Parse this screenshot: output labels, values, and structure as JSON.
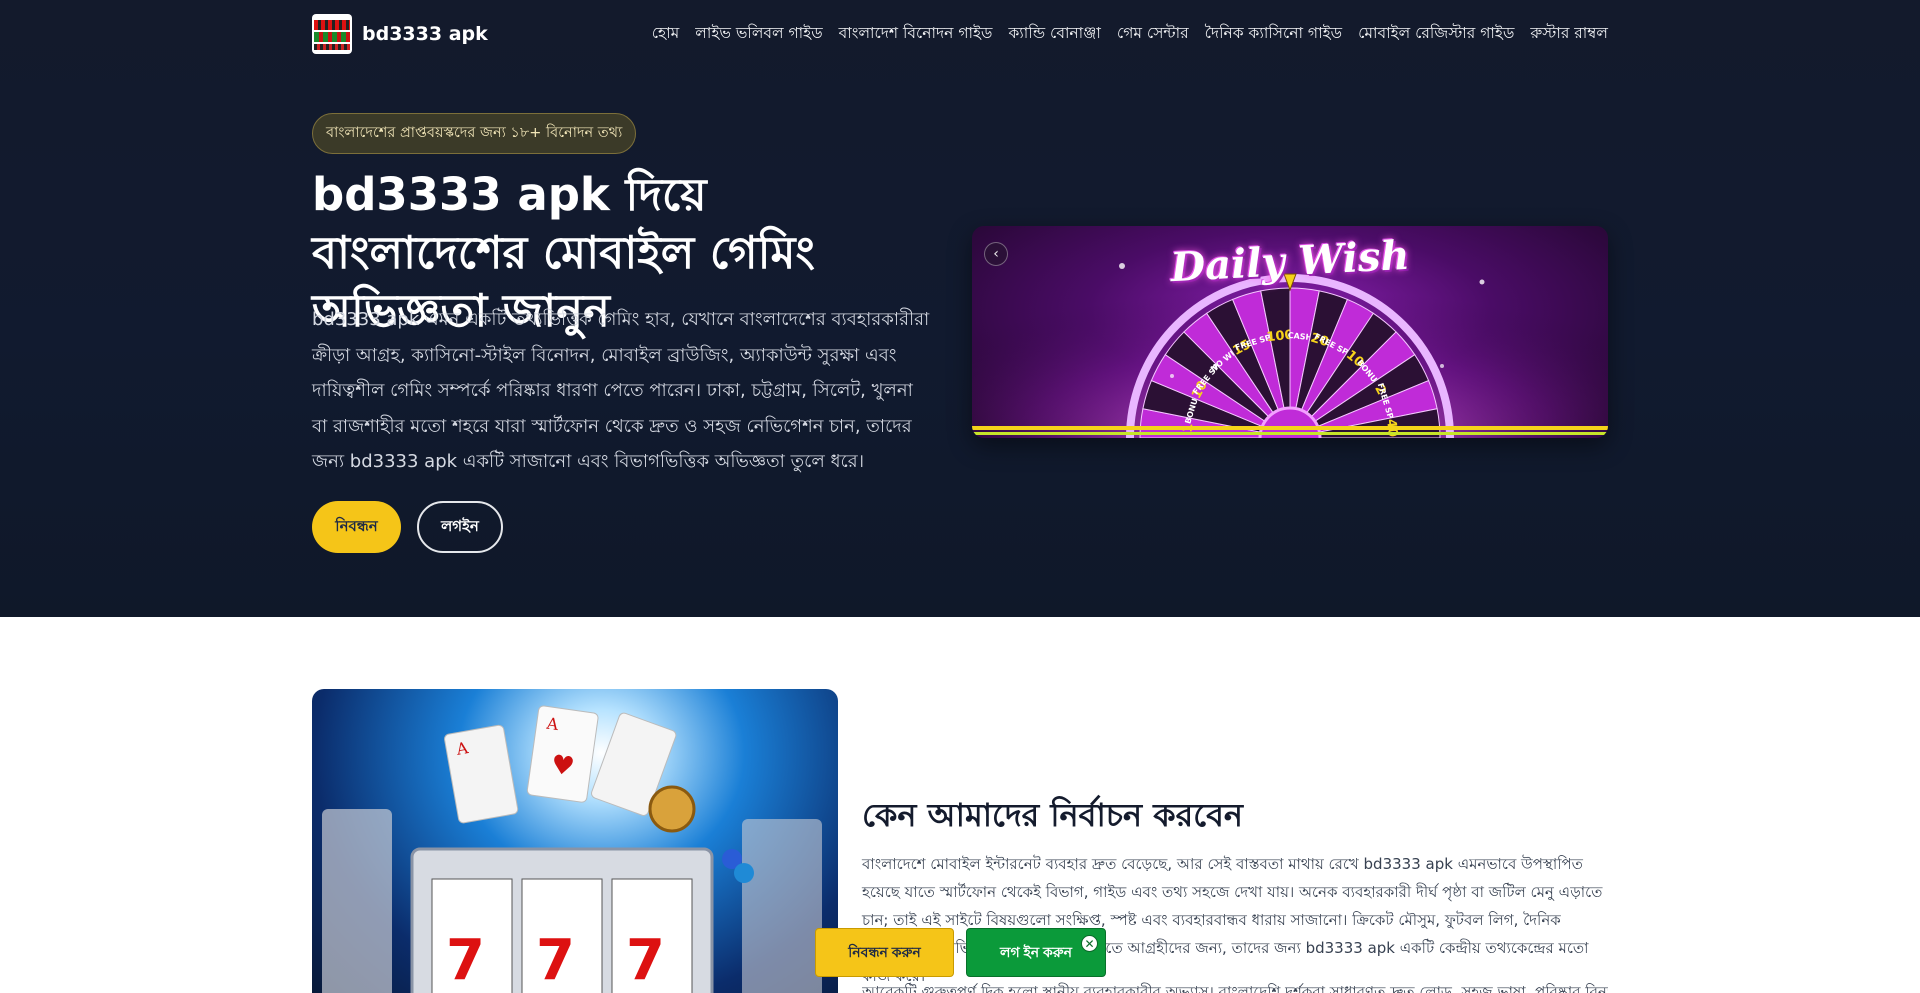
{
  "header": {
    "brand_name": "bd3333 apk",
    "nav": [
      "হোম",
      "লাইভ ভলিবল গাইড",
      "বাংলাদেশ বিনোদন গাইড",
      "ক্যান্ডি বোনাঞ্জা",
      "গেম সেন্টার",
      "দৈনিক ক্যাসিনো গাইড",
      "মোবাইল রেজিস্টার গাইড",
      "রুস্টার রাম্বল"
    ]
  },
  "hero": {
    "badge": "বাংলাদেশের প্রাপ্তবয়স্কদের জন্য ১৮+ বিনোদন তথ্য",
    "title": "bd3333 apk দিয়ে বাংলাদেশের মোবাইল গেমিং অভিজ্ঞতা জানুন",
    "description": "bd3333 apk এমন একটি তথ্যভিত্তিক গেমিং হাব, যেখানে বাংলাদেশের ব্যবহারকারীরা ক্রীড়া আগ্রহ, ক্যাসিনো-স্টাইল বিনোদন, মোবাইল ব্রাউজিং, অ্যাকাউন্ট সুরক্ষা এবং দায়িত্বশীল গেমিং সম্পর্কে পরিষ্কার ধারণা পেতে পারেন। ঢাকা, চট্টগ্রাম, সিলেট, খুলনা বা রাজশাহীর মতো শহরে যারা স্মার্টফোন থেকে দ্রুত ও সহজ নেভিগেশন চান, তাদের জন্য bd3333 apk একটি সাজানো এবং বিভাগভিত্তিক অভিজ্ঞতা তুলে ধরে।",
    "register_label": "নিবন্ধন",
    "login_label": "লগইন",
    "carousel": {
      "prev_icon": "‹",
      "slide_title": "Daily Wish",
      "wheel_segments": [
        "1",
        "BONUS",
        "10",
        "FREE SPINS",
        "NO WIN",
        "15",
        "FREE SPINS",
        "100",
        "CASH",
        "20",
        "FREE SPINS",
        "10",
        "BONUS",
        "2",
        "FREE SPINS",
        "40"
      ],
      "colors": {
        "magenta": "#c02bd8",
        "yellow": "#f5d31a",
        "dark": "#2b1034"
      }
    }
  },
  "why": {
    "title": "কেন আমাদের নির্বাচন করবেন",
    "paragraph": "বাংলাদেশে মোবাইল ইন্টারনেট ব্যবহার দ্রুত বেড়েছে, আর সেই বাস্তবতা মাথায় রেখে bd3333 apk এমনভাবে উপস্থাপিত হয়েছে যাতে স্মার্টফোন থেকেই বিভাগ, গাইড এবং তথ্য সহজে দেখা যায়। অনেক ব্যবহারকারী দীর্ঘ পৃষ্ঠা বা জটিল মেনু এড়াতে চান; তাই এই সাইটে বিষয়গুলো সংক্ষিপ্ত, স্পষ্ট এবং ব্যবহারবান্ধব ধারায় সাজানো। ক্রিকেট মৌসুম, ফুটবল লিগ, দৈনিক বিনোদন বা থিমভিত্তিক গেম সম্পর্কে জানতে আগ্রহীদের জন্য, তাদের জন্য bd3333 apk একটি কেন্দ্রীয় তথ্যকেন্দ্রের মতো কাজ করে।",
    "paragraph2": "আরেকটি গুরুত্বপূর্ণ দিক হলো স্থানীয় ব্যবহারকারীর অভ্যাস। বাংলাদেশি দর্শকরা সাধারণত দ্রুত লোড, সহজ ভাষা, পরিষ্কার বিন্যাস"
  },
  "sticky": {
    "register_label": "নিবন্ধন করুন",
    "login_label": "লগ ইন করুন",
    "close_icon": "✕"
  },
  "theme": {
    "hero_bg": "#111a2f",
    "accent_yellow": "#f5c518",
    "accent_green": "#0b9a3a"
  }
}
